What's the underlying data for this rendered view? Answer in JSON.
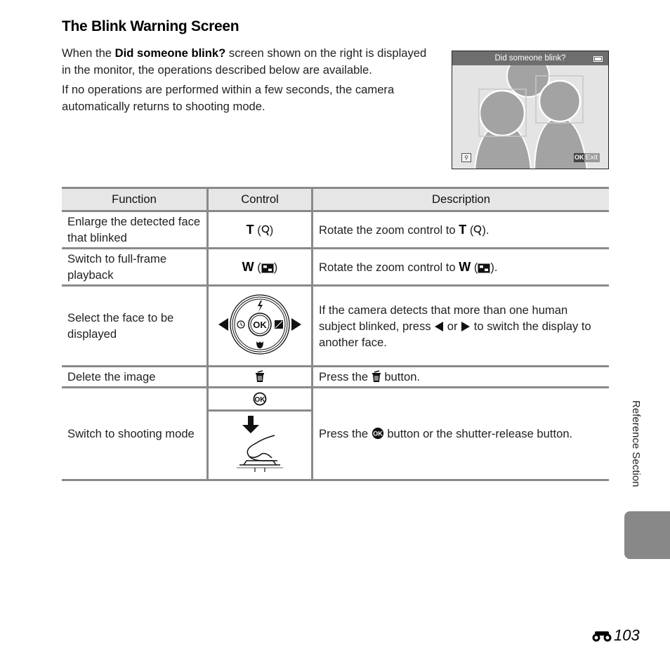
{
  "page": {
    "title": "The Blink Warning Screen",
    "intro": {
      "p1_before": "When the ",
      "p1_bold": "Did someone blink?",
      "p1_after": " screen shown on the right is displayed in the monitor, the operations described below are available.",
      "p2": "If no operations are performed within a few seconds, the camera automatically returns to shooting mode."
    },
    "monitor": {
      "header": "Did someone blink?",
      "battery_icon": "battery-icon",
      "zoom_icon": "magnify-icon",
      "exit_ok": "OK",
      "exit_label": "Exit"
    },
    "table": {
      "headers": [
        "Function",
        "Control",
        "Description"
      ],
      "rows": [
        {
          "function": "Enlarge the detected face that blinked",
          "control_letter": "T",
          "control_icon": "magnify-icon",
          "desc_before": "Rotate the zoom control to ",
          "desc_letter": "T",
          "desc_icon": "magnify-icon",
          "desc_after": "."
        },
        {
          "function": "Switch to full-frame playback",
          "control_letter": "W",
          "control_icon": "thumbnail-grid-icon",
          "desc_before": "Rotate the zoom control to ",
          "desc_letter": "W",
          "desc_icon": "thumbnail-grid-icon",
          "desc_after": "."
        },
        {
          "function": "Select the face to be displayed",
          "control_icon": "multi-selector-icon",
          "control_center": "OK",
          "desc_before": "If the camera detects that more than one human subject blinked, press ",
          "desc_left_icon": "left-arrow-icon",
          "desc_mid": " or ",
          "desc_right_icon": "right-arrow-icon",
          "desc_after": " to switch the display to another face."
        },
        {
          "function": "Delete the image",
          "control_icon": "trash-icon",
          "desc_before": "Press the ",
          "desc_icon": "trash-icon",
          "desc_after": " button."
        },
        {
          "function": "Switch to shooting mode",
          "control_icons": [
            "ok-button-icon",
            "shutter-release-icon"
          ],
          "desc_before": "Press the ",
          "desc_icon": "ok-button-icon",
          "desc_after": " button or the shutter-release button."
        }
      ]
    },
    "side_label": "Reference Section",
    "page_number": "103",
    "page_prefix_icon": "binoculars-icon"
  }
}
